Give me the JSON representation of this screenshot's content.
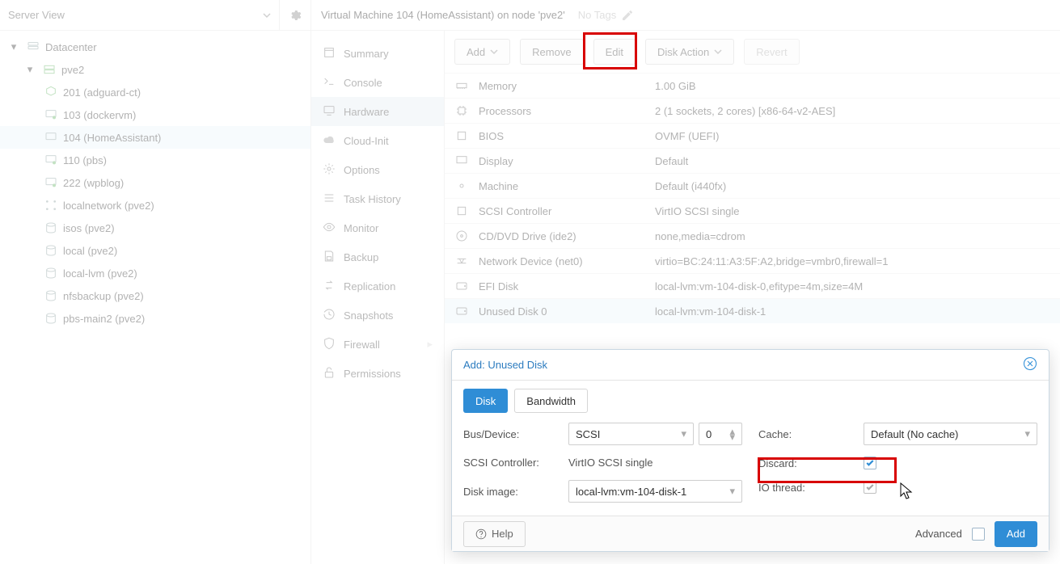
{
  "view_select": "Server View",
  "tree": {
    "datacenter": "Datacenter",
    "node": "pve2",
    "items": [
      {
        "label": "201 (adguard-ct)",
        "icon": "lxc"
      },
      {
        "label": "103 (dockervm)",
        "icon": "vm"
      },
      {
        "label": "104 (HomeAssistant)",
        "icon": "vm",
        "selected": true
      },
      {
        "label": "110 (pbs)",
        "icon": "vm"
      },
      {
        "label": "222 (wpblog)",
        "icon": "vm"
      },
      {
        "label": "localnetwork (pve2)",
        "icon": "net"
      },
      {
        "label": "isos (pve2)",
        "icon": "stor"
      },
      {
        "label": "local (pve2)",
        "icon": "stor"
      },
      {
        "label": "local-lvm (pve2)",
        "icon": "stor"
      },
      {
        "label": "nfsbackup (pve2)",
        "icon": "stor"
      },
      {
        "label": "pbs-main2 (pve2)",
        "icon": "stor"
      }
    ]
  },
  "titlebar": {
    "title": "Virtual Machine 104 (HomeAssistant) on node 'pve2'",
    "notags": "No Tags"
  },
  "menu": [
    {
      "label": "Summary",
      "icon": "summary"
    },
    {
      "label": "Console",
      "icon": "console"
    },
    {
      "label": "Hardware",
      "icon": "monitor",
      "active": true
    },
    {
      "label": "Cloud-Init",
      "icon": "cloud"
    },
    {
      "label": "Options",
      "icon": "gear"
    },
    {
      "label": "Task History",
      "icon": "list"
    },
    {
      "label": "Monitor",
      "icon": "eye"
    },
    {
      "label": "Backup",
      "icon": "save"
    },
    {
      "label": "Replication",
      "icon": "repl"
    },
    {
      "label": "Snapshots",
      "icon": "snap"
    },
    {
      "label": "Firewall",
      "icon": "shield",
      "chev": true
    },
    {
      "label": "Permissions",
      "icon": "lock"
    }
  ],
  "toolbar": {
    "add": "Add",
    "remove": "Remove",
    "edit": "Edit",
    "disk_action": "Disk Action",
    "revert": "Revert"
  },
  "hw": [
    {
      "name": "Memory",
      "val": "1.00 GiB",
      "icon": "mem"
    },
    {
      "name": "Processors",
      "val": "2 (1 sockets, 2 cores) [x86-64-v2-AES]",
      "icon": "cpu"
    },
    {
      "name": "BIOS",
      "val": "OVMF (UEFI)",
      "icon": "chip"
    },
    {
      "name": "Display",
      "val": "Default",
      "icon": "mon"
    },
    {
      "name": "Machine",
      "val": "Default (i440fx)",
      "icon": "gear"
    },
    {
      "name": "SCSI Controller",
      "val": "VirtIO SCSI single",
      "icon": "chip"
    },
    {
      "name": "CD/DVD Drive (ide2)",
      "val": "none,media=cdrom",
      "icon": "cd"
    },
    {
      "name": "Network Device (net0)",
      "val": "virtio=BC:24:11:A3:5F:A2,bridge=vmbr0,firewall=1",
      "icon": "net"
    },
    {
      "name": "EFI Disk",
      "val": "local-lvm:vm-104-disk-0,efitype=4m,size=4M",
      "icon": "hdd"
    },
    {
      "name": "Unused Disk 0",
      "val": "local-lvm:vm-104-disk-1",
      "icon": "hdd",
      "selected": true
    }
  ],
  "dialog": {
    "title": "Add: Unused Disk",
    "tabs": {
      "disk": "Disk",
      "bandwidth": "Bandwidth"
    },
    "left": {
      "bus_label": "Bus/Device:",
      "bus_val": "SCSI",
      "bus_num": "0",
      "ctrl_label": "SCSI Controller:",
      "ctrl_val": "VirtIO SCSI single",
      "img_label": "Disk image:",
      "img_val": "local-lvm:vm-104-disk-1"
    },
    "right": {
      "cache_label": "Cache:",
      "cache_val": "Default (No cache)",
      "discard_label": "Discard:",
      "iothread_label": "IO thread:"
    },
    "foot": {
      "help": "Help",
      "advanced": "Advanced",
      "add": "Add"
    }
  }
}
